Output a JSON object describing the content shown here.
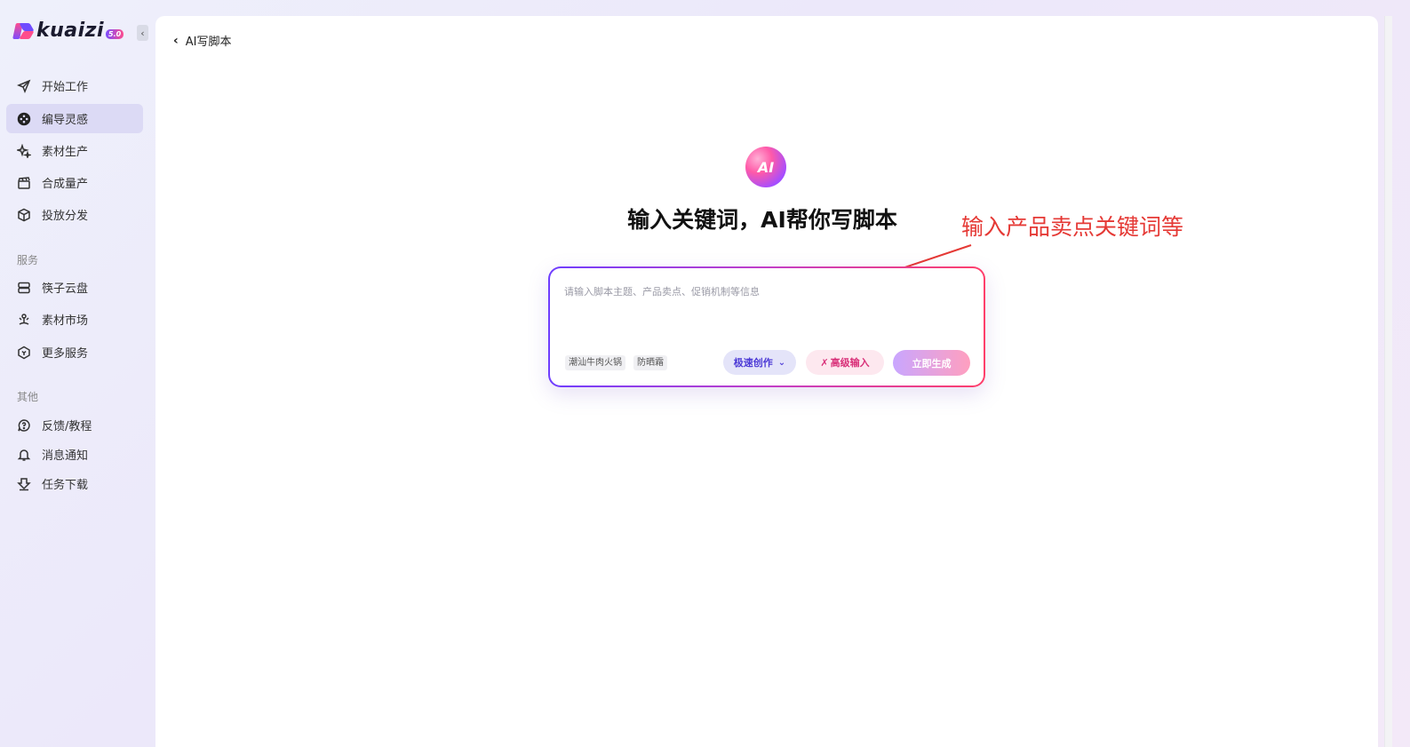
{
  "sidebar": {
    "logo_text": "kuaizi",
    "logo_badge": "5.0",
    "collapse_glyph": "‹",
    "items": [
      {
        "label": "开始工作",
        "icon": "paper-plane-icon"
      },
      {
        "label": "编导灵感",
        "icon": "film-reel-icon",
        "active": true
      },
      {
        "label": "素材生产",
        "icon": "sparkle-icon"
      },
      {
        "label": "合成量产",
        "icon": "clapperboard-icon"
      },
      {
        "label": "投放分发",
        "icon": "cube-icon"
      }
    ],
    "section_services": "服务",
    "services": [
      {
        "label": "筷子云盘",
        "icon": "storage-icon"
      },
      {
        "label": "素材市场",
        "icon": "market-icon"
      },
      {
        "label": "更多服务",
        "icon": "hexagon-icon"
      }
    ],
    "section_other": "其他",
    "other": [
      {
        "label": "反馈/教程",
        "icon": "feedback-icon"
      },
      {
        "label": "消息通知",
        "icon": "bell-icon"
      },
      {
        "label": "任务下载",
        "icon": "download-icon"
      }
    ]
  },
  "header": {
    "back_label": "AI写脚本"
  },
  "main": {
    "ai_logo_text": "AI",
    "headline": "输入关键词，AI帮你写脚本",
    "input": {
      "placeholder": "请输入脚本主题、产品卖点、促销机制等信息",
      "tags": [
        "潮汕牛肉火锅",
        "防晒霜"
      ],
      "mode_label": "极速创作",
      "advanced_label": "高级输入",
      "generate_label": "立即生成"
    }
  },
  "annotation": {
    "text": "输入产品卖点关键词等",
    "color": "#e53935"
  },
  "colors": {
    "accent_purple": "#6e3dff",
    "accent_pink": "#ff3f6b"
  }
}
